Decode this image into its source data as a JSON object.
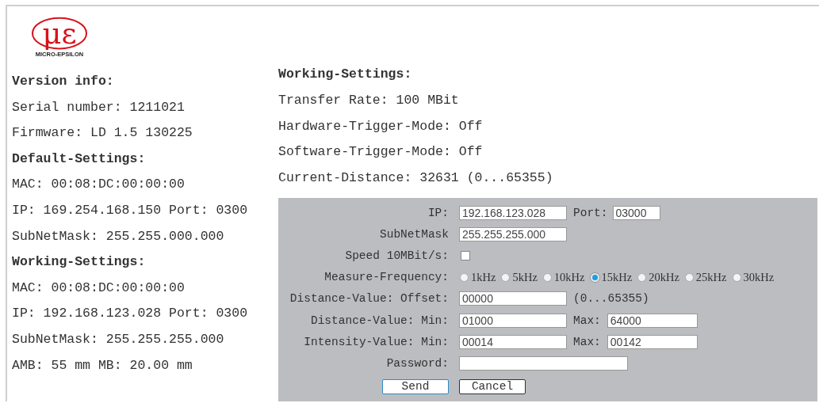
{
  "logo": {
    "mark": "με",
    "name": "MICRO-EPSILON"
  },
  "left_sections": [
    {
      "heading": "Version info:",
      "lines": [
        "Serial number: 1211021",
        "Firmware: LD 1.5 130225"
      ]
    },
    {
      "heading": "Default-Settings:",
      "lines": [
        "MAC: 00:08:DC:00:00:00",
        "IP: 169.254.168.150 Port: 0300",
        "SubNetMask: 255.255.000.000"
      ]
    },
    {
      "heading": "Working-Settings:",
      "lines": [
        "MAC: 00:08:DC:00:00:00",
        "IP: 192.168.123.028 Port: 0300",
        "SubNetMask: 255.255.255.000",
        "AMB: 55 mm MB: 20.00 mm"
      ]
    }
  ],
  "right_section": {
    "heading": "Working-Settings:",
    "lines": [
      "Transfer Rate: 100 MBit",
      "Hardware-Trigger-Mode: Off",
      "Software-Trigger-Mode: Off",
      "Current-Distance: 32631 (0...65355)"
    ]
  },
  "form": {
    "rows": [
      {
        "label": "IP:",
        "parts": [
          {
            "kind": "field",
            "value": "192.168.123.028"
          },
          {
            "kind": "text",
            "text": "Port:"
          },
          {
            "kind": "short-field",
            "value": "03000"
          }
        ]
      },
      {
        "label": "SubNetMask",
        "parts": [
          {
            "kind": "field",
            "value": "255.255.255.000"
          }
        ]
      },
      {
        "label": "Speed 10MBit/s:",
        "parts": [
          {
            "kind": "checkbox",
            "checked": false
          }
        ]
      },
      {
        "label": "Measure-Frequency:",
        "parts": [
          {
            "kind": "radios",
            "options": [
              {
                "label": "1kHz",
                "selected": false
              },
              {
                "label": "5kHz",
                "selected": false
              },
              {
                "label": "10kHz",
                "selected": false
              },
              {
                "label": "15kHz",
                "selected": true
              },
              {
                "label": "20kHz",
                "selected": false
              },
              {
                "label": "25kHz",
                "selected": false
              },
              {
                "label": "30kHz",
                "selected": false
              }
            ]
          }
        ]
      },
      {
        "label": "Distance-Value: Offset:",
        "parts": [
          {
            "kind": "field",
            "value": "00000"
          },
          {
            "kind": "text",
            "text": "(0...65355)"
          }
        ]
      },
      {
        "label": "Distance-Value: Min:",
        "parts": [
          {
            "kind": "field",
            "value": "01000"
          },
          {
            "kind": "text",
            "text": "Max:"
          },
          {
            "kind": "medium-field",
            "value": "64000"
          }
        ]
      },
      {
        "label": "Intensity-Value: Min:",
        "parts": [
          {
            "kind": "field",
            "value": "00014"
          },
          {
            "kind": "text",
            "text": "Max:"
          },
          {
            "kind": "medium-field",
            "value": "00142"
          }
        ]
      },
      {
        "label": "Password:",
        "parts": [
          {
            "kind": "wide-field"
          }
        ]
      }
    ],
    "buttons": [
      {
        "label": "Send",
        "focused": true
      },
      {
        "label": "Cancel",
        "focused": false
      }
    ]
  }
}
